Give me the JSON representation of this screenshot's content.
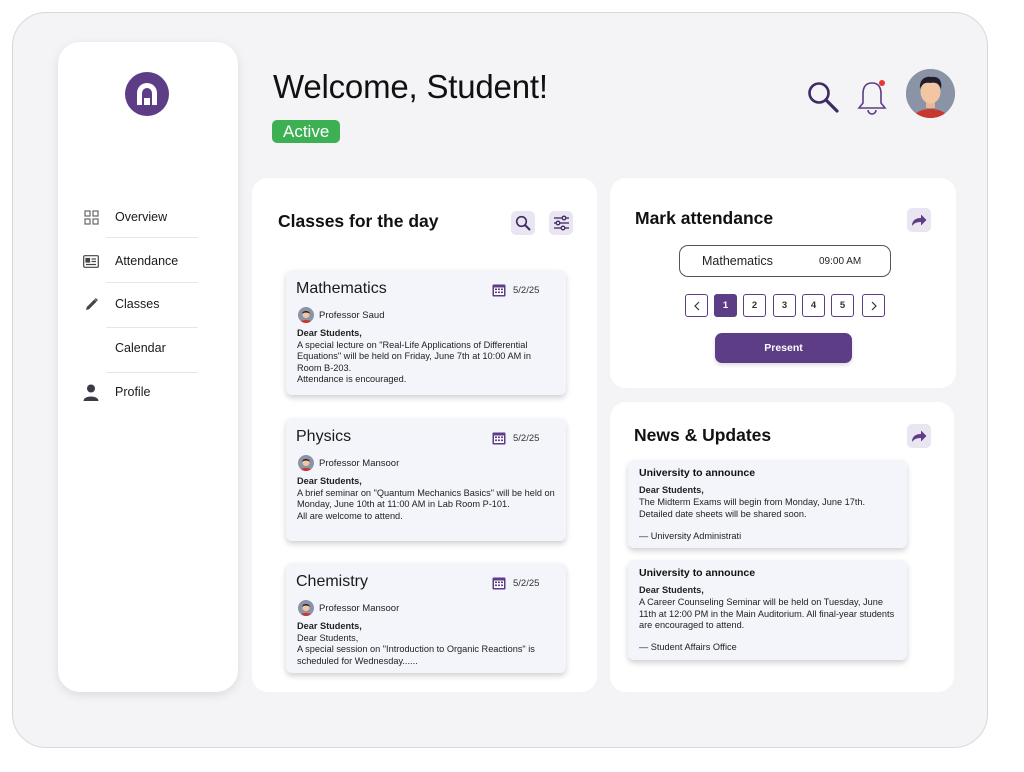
{
  "colors": {
    "accent": "#5d3d86",
    "active_green": "#3db054",
    "notification_dot": "#e53935"
  },
  "sidebar": {
    "items": [
      {
        "label": "Overview",
        "icon": "grid-icon"
      },
      {
        "label": "Attendance",
        "icon": "id-card-icon"
      },
      {
        "label": "Classes",
        "icon": "pencil-icon"
      },
      {
        "label": "Calendar",
        "icon": ""
      },
      {
        "label": "Profile",
        "icon": "person-icon"
      }
    ]
  },
  "header": {
    "welcome": "Welcome, Student!",
    "status": "Active"
  },
  "classes": {
    "title": "Classes for the day",
    "cards": [
      {
        "subject": "Mathematics",
        "date": "5/2/25",
        "professor": "Professor Saud",
        "salutation": "Dear Students,",
        "body": "A special lecture on \"Real-Life Applications of Differential Equations\" will be held on Friday, June 7th at 10:00 AM in Room B-203.",
        "closing": "Attendance is encouraged."
      },
      {
        "subject": "Physics",
        "date": "5/2/25",
        "professor": "Professor Mansoor",
        "salutation": "Dear Students,",
        "body": "A brief seminar on \"Quantum Mechanics Basics\" will be held on Monday, June 10th at 11:00 AM in Lab Room P-101.",
        "closing": "All are welcome to attend."
      },
      {
        "subject": "Chemistry",
        "date": "5/2/25",
        "professor": "Professor Mansoor",
        "salutation": "Dear Students,",
        "body": "Dear Students,",
        "closing": "A special session on \"Introduction to Organic Reactions\" is scheduled for Wednesday......"
      }
    ]
  },
  "attendance": {
    "title": "Mark attendance",
    "subject": "Mathematics",
    "time": "09:00 AM",
    "pages": [
      "1",
      "2",
      "3",
      "4",
      "5"
    ],
    "active_page": "1",
    "prev_symbol": "<",
    "next_symbol": ">",
    "present_label": "Present"
  },
  "news": {
    "title": "News & Updates",
    "items": [
      {
        "title": "University to announce",
        "salutation": "Dear Students,",
        "body": "The Midterm Exams will begin from Monday, June 17th. Detailed date sheets will be shared soon.",
        "sign": "— University Administrati"
      },
      {
        "title": "University to announce",
        "salutation": "Dear Students,",
        "body": "A Career Counseling Seminar will be held on Tuesday, June 11th at 12:00 PM in the Main Auditorium. All final-year students are encouraged to attend.",
        "sign": "— Student Affairs Office"
      }
    ]
  }
}
